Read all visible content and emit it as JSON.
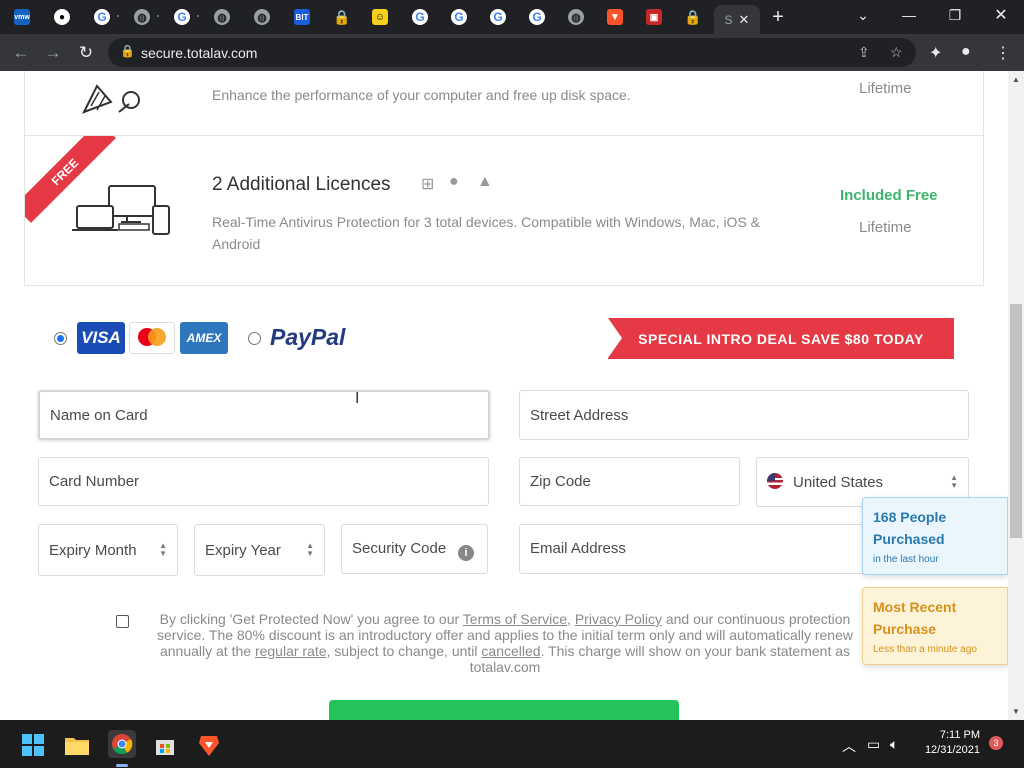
{
  "browser": {
    "url": "secure.totalav.com",
    "active_tab_label": "S",
    "tab_favicons": [
      "vmw",
      "github",
      "google",
      "google",
      "google",
      "globe",
      "globe",
      "bitwarden",
      "lock",
      "face",
      "google",
      "google",
      "google",
      "google",
      "globe",
      "brave",
      "bag",
      "lock"
    ]
  },
  "features": [
    {
      "description": "Enhance the performance of your computer and free up disk space.",
      "duration": "Lifetime"
    },
    {
      "ribbon": "FREE",
      "title": "2 Additional Licences",
      "description": "Real-Time Antivirus Protection for 3 total devices. Compatible with Windows, Mac, iOS & Android",
      "price": "Included Free",
      "duration": "Lifetime"
    }
  ],
  "payment": {
    "selected_method": "card",
    "card_brands": [
      "VISA",
      "mastercard",
      "AMEX"
    ],
    "paypal_label": "PayPal",
    "deal_banner": "SPECIAL INTRO DEAL SAVE $80 TODAY"
  },
  "form": {
    "name_on_card": "Name on Card",
    "street_address": "Street Address",
    "card_number": "Card Number",
    "zip_code": "Zip Code",
    "country": "United States",
    "expiry_month": "Expiry Month",
    "expiry_year": "Expiry Year",
    "security_code": "Security Code",
    "email": "Email Address"
  },
  "terms": {
    "t1": "By clicking 'Get Protected Now' you agree to our ",
    "tos": "Terms of Service",
    "sep": ", ",
    "privacy": "Privacy Policy",
    "t2": " and our continuous protection service. The 80% discount is an introductory offer and applies to the initial term only and will automatically renew annually at the ",
    "regular": "regular rate",
    "t3": ", subject to change, until ",
    "cancelled": "cancelled",
    "t4": ". This charge will show on your bank statement as totalav.com"
  },
  "notifications": [
    {
      "line1": "168 People",
      "line2": "Purchased",
      "sub": "in the last hour",
      "color": "#2a7ab0"
    },
    {
      "line1": "Most Recent",
      "line2": "Purchase",
      "sub": "Less than a minute ago",
      "color": "#d9901a"
    }
  ],
  "taskbar": {
    "time": "7:11 PM",
    "date": "12/31/2021",
    "notification_count": "3"
  }
}
